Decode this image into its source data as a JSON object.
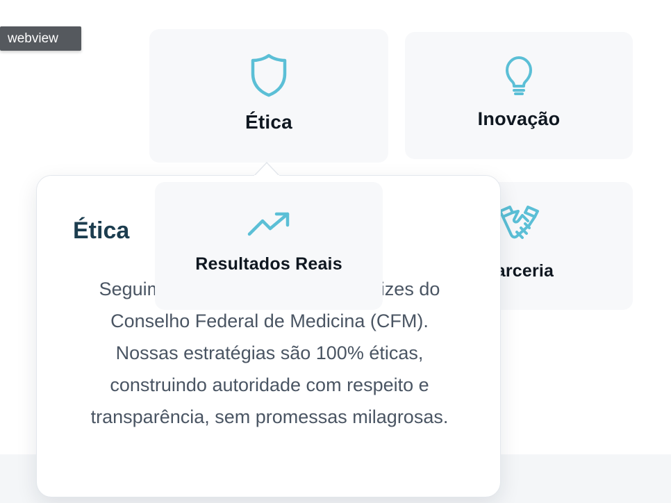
{
  "webview_tag": "webview",
  "cards": {
    "etica": {
      "label": "Ética",
      "icon": "shield-icon"
    },
    "inovacao": {
      "label": "Inovação",
      "icon": "lightbulb-icon"
    },
    "resultados": {
      "label": "Resultados Reais",
      "icon": "trending-up-icon"
    },
    "parceria": {
      "label": "Parceria",
      "icon": "handshake-icon"
    }
  },
  "popover": {
    "title": "Ética",
    "text": "Seguimos rigorosamente as diretrizes do Conselho Federal de Medicina (CFM). Nossas estratégias são 100% éticas, construindo autoridade com respeito e transparência, sem promessas milagrosas."
  },
  "colors": {
    "accent": "#5bbfd6",
    "title": "#1c3d4f",
    "body_text": "#4a5563",
    "card_bg": "#f7f8fa"
  }
}
